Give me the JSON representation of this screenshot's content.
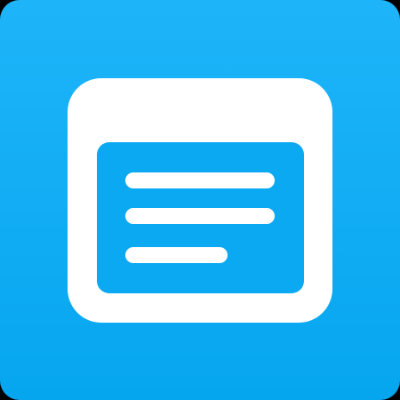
{
  "icon": {
    "name": "notes-app-icon",
    "glyph": "document-with-lines-icon",
    "colors": {
      "background_top": "#1eb4f9",
      "background_bottom": "#06a6ef",
      "frame": "#ffffff",
      "content_panel": "#0aa9f1",
      "lines": "#ffffff"
    }
  }
}
